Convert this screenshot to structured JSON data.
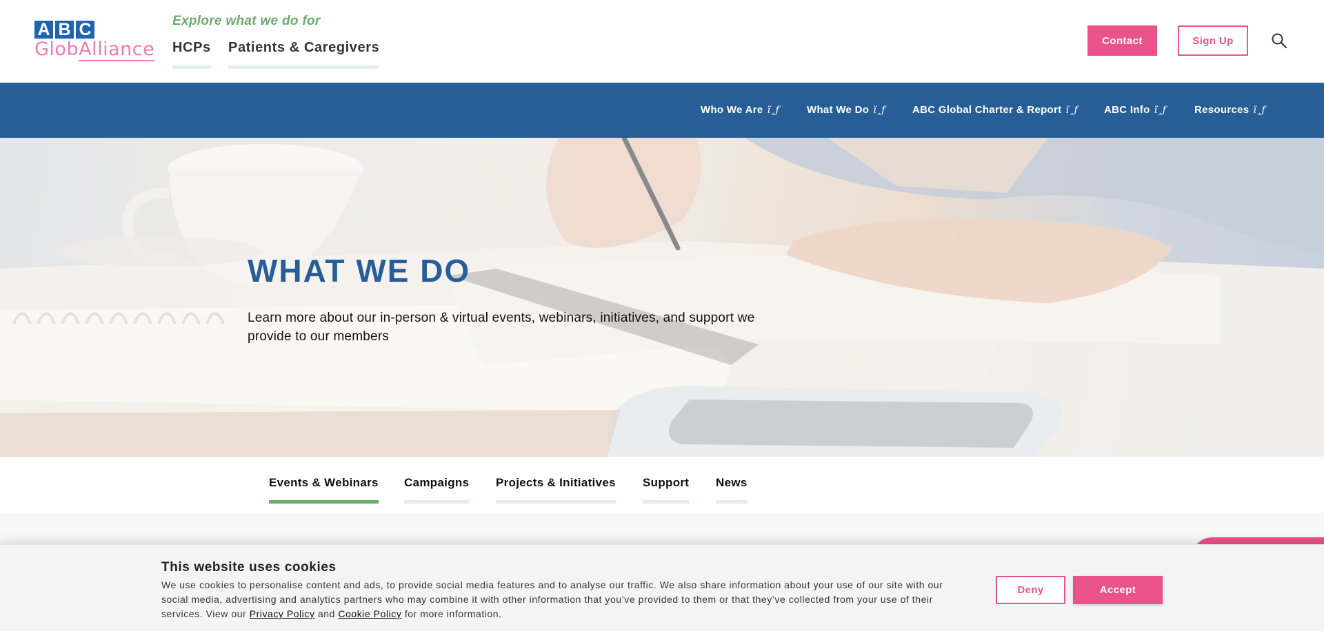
{
  "logo": {
    "abc_letters": [
      "A",
      "B",
      "C"
    ],
    "line2_part1": "Glob",
    "line2_part2": "Alliance"
  },
  "header": {
    "explore_label": "Explore what we do for",
    "audiences": [
      "HCPs",
      "Patients & Caregivers"
    ],
    "contact_label": "Contact",
    "signup_label": "Sign Up",
    "search_icon": "search-icon"
  },
  "nav": {
    "caret_glyph": "ï¸ƒ",
    "items": [
      "Who We Are",
      "What We Do",
      "ABC Global Charter & Report",
      "ABC Info",
      "Resources"
    ]
  },
  "hero": {
    "title": "WHAT WE DO",
    "subtitle": "Learn more about our in-person & virtual events, webinars, initiatives, and support we provide to our members"
  },
  "tabs": {
    "items": [
      "Events & Webinars",
      "Campaigns",
      "Projects & Initiatives",
      "Support",
      "News"
    ],
    "active": "Events & Webinars"
  },
  "cookie": {
    "title": "This website uses cookies",
    "text_before": "We use cookies to personalise content and ads, to provide social media features and to analyse our traffic. We also share information about your use of our site with our social media, advertising and analytics partners who may combine it with other information that you’ve provided to them or that they’ve collected from your use of their services. View our ",
    "privacy_link": "Privacy Policy",
    "and_text": " and ",
    "cookie_link": "Cookie Policy",
    "text_after": " for more information.",
    "deny_label": "Deny",
    "accept_label": "Accept"
  },
  "colors": {
    "brand_blue": "#275e97",
    "logo_blue": "#1f64b0",
    "brand_pink": "#e9528b",
    "accent_green": "#6bab6b",
    "tab_underline_light": "#e3efe3"
  }
}
